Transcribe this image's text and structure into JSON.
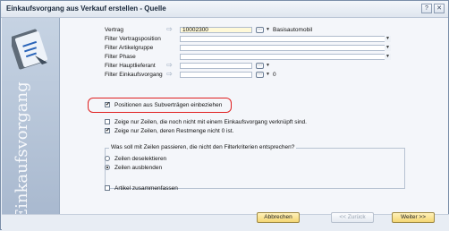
{
  "window": {
    "title": "Einkaufsvorgang aus Verkauf erstellen - Quelle"
  },
  "sidebar": {
    "vertical_label": "Einkaufsvorgang"
  },
  "form": {
    "vertrag_label": "Vertrag",
    "vertrag_value": "10002300",
    "vertrag_desc": "Basisautomobil",
    "filter_vertragsposition_label": "Filter Vertragsposition",
    "filter_artikelgruppe_label": "Filter Artikelgruppe",
    "filter_phase_label": "Filter Phase",
    "filter_hauptlieferant_label": "Filter Hauptlieferant",
    "filter_einkaufsvorgang_label": "Filter Einkaufsvorgang",
    "filter_einkaufsvorgang_value": "0"
  },
  "options": {
    "positionen_label": "Positionen aus Subverträgen einbeziehen",
    "positionen_checked": true,
    "zeile_nicht_verknuepft_label": "Zeige nur Zeilen, die noch nicht mit einem Einkaufsvorgang verknüpft sind.",
    "zeile_nicht_verknuepft_checked": false,
    "zeile_restmenge_label": "Zeige nur Zeilen, deren Restmenge nicht 0 ist.",
    "zeile_restmenge_checked": true,
    "artikel_zusammenfassen_label": "Artikel zusammenfassen",
    "artikel_zusammenfassen_checked": false
  },
  "filter_group": {
    "title": "Was soll mit Zeilen passieren, die nicht den Filterkriterien entsprechen?",
    "option_deselect": "Zeilen deselektieren",
    "option_hide": "Zeilen ausblenden",
    "selected": "hide"
  },
  "buttons": {
    "cancel": "Abbrechen",
    "back": "<< Zurück",
    "next": "Weiter >>"
  },
  "window_buttons": {
    "help": "?",
    "close": "✕"
  }
}
